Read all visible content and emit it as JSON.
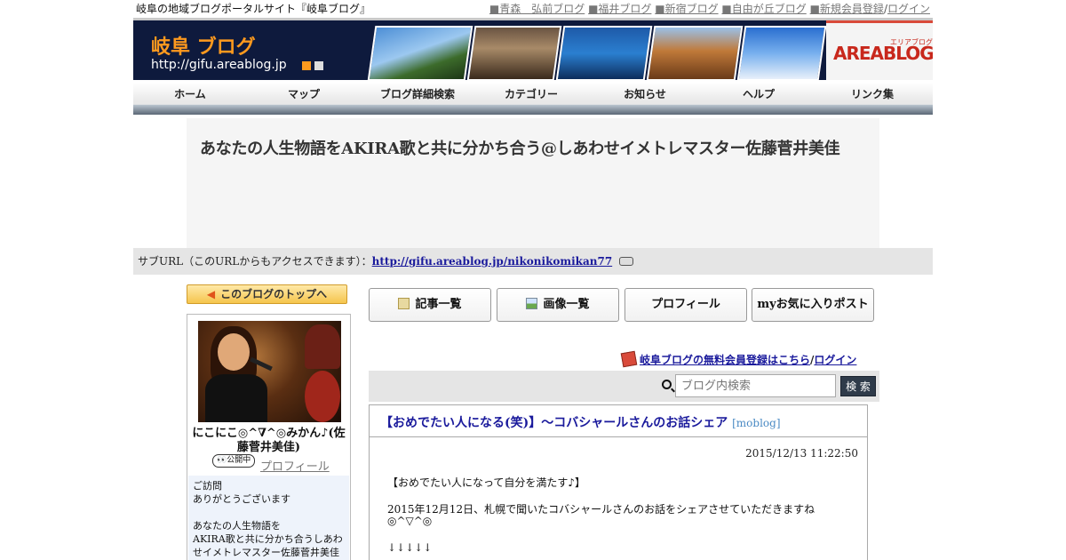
{
  "topbar": {
    "tagline": "岐阜の地域ブログポータルサイト『岐阜ブログ』",
    "links": [
      "■青森　弘前ブログ",
      "■福井ブログ",
      "■新宿ブログ",
      "■自由が丘ブログ",
      "■新規会員登録",
      "ログイン"
    ]
  },
  "banner": {
    "logo": "岐阜 ブログ",
    "url": "http://gifu.areablog.jp",
    "brand": "AREABLOG",
    "brand_sub": "エリアブログ"
  },
  "nav": [
    "ホーム",
    "マップ",
    "ブログ詳細検索",
    "カテゴリー",
    "お知らせ",
    "ヘルプ",
    "リンク集"
  ],
  "blog": {
    "title": "あなたの人生物語をAKIRA歌と共に分かち合う@しあわせイメトレマスター佐藤菅井美佳"
  },
  "suburl": {
    "label": "サブURL（このURLからもアクセスできます）：",
    "url": "http://gifu.areablog.jp/nikonikomikan77"
  },
  "sidebar": {
    "top_button": "このブログのトップへ",
    "nickname": "にこにこ◎^∇^◎みかん♪(佐藤菅井美佳)",
    "public_badge": "公開中",
    "profile_link": "プロフィール",
    "bio": [
      "ご訪問",
      "ありがとうございます",
      "",
      "あなたの人生物語を",
      "AKIRA歌と共に分かち合うしあわ",
      "せイメトレマスター佐藤菅井美佳"
    ]
  },
  "tabs": [
    "記事一覧",
    "画像一覧",
    "プロフィール",
    "myお気に入りポスト"
  ],
  "register": {
    "text": "岐阜ブログの無料会員登録はこちら",
    "sep": "/",
    "login": "ログイン"
  },
  "search": {
    "placeholder": "ブログ内検索",
    "button": "検 索"
  },
  "post": {
    "title": "【おめでたい人になる(笑)】～コバシャールさんのお話シェア",
    "tag": "[moblog]",
    "date": "2015/12/13 11:22:50",
    "lines": [
      "【おめでたい人になって自分を満たす♪】",
      "2015年12月12日、札幌で聞いたコバシャールさんのお話をシェアさせていただきますね",
      "◎^▽^◎",
      "↓↓↓↓↓"
    ]
  },
  "colors": {
    "banner_bg": "#0e1a3d",
    "logo_orange": "#ff9a1e",
    "link_blue": "#1a1a9c",
    "search_button": "#2f3b4a"
  }
}
